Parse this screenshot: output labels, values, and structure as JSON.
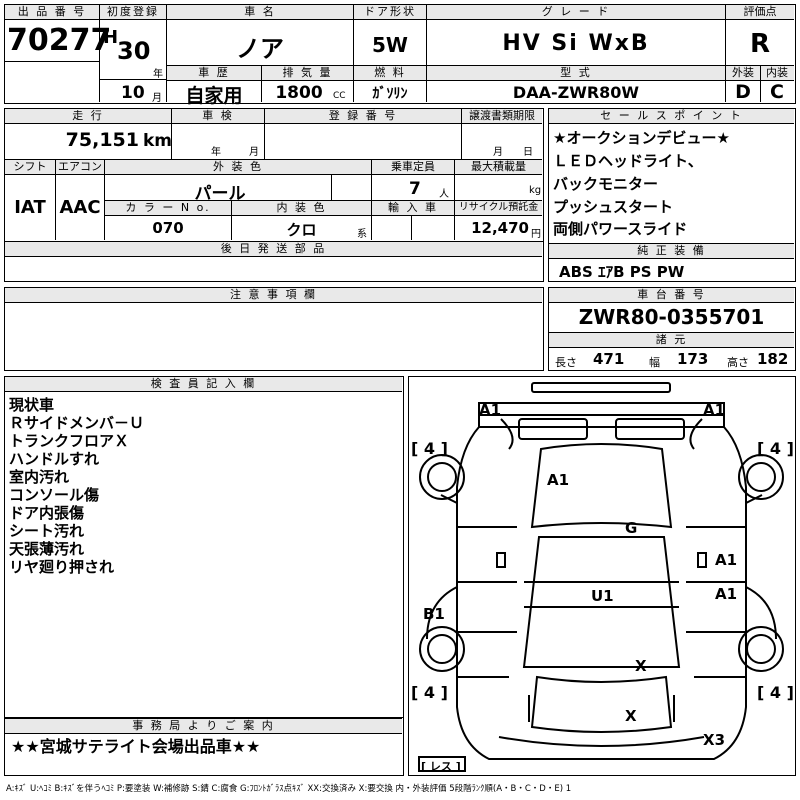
{
  "header": {
    "lot_no_label": "出 品 番 号",
    "lot_no": "70277",
    "first_reg_label": "初度登録",
    "era": "H",
    "year": "30",
    "year_unit": "年",
    "month": "10",
    "month_unit": "月",
    "car_name_label": "車 名",
    "car_name": "ノア",
    "history_label": "車 歴",
    "history": "自家用",
    "displacement_label": "排 気 量",
    "displacement": "1800",
    "displacement_unit": "CC",
    "door_label": "ドア形状",
    "door": "5W",
    "fuel_label": "燃 料",
    "fuel": "ｶﾞｿﾘﾝ",
    "grade_label": "グ レ ー ド",
    "grade": "HV Si WxB",
    "model_label": "型 式",
    "model": "DAA-ZWR80W",
    "score_label": "評価点",
    "score": "R",
    "ext_label": "外装",
    "ext": "D",
    "int_label": "内装",
    "int": "C"
  },
  "row2": {
    "mileage_label": "走 行",
    "mileage": "75,151",
    "mileage_unit": "km",
    "inspection_label": "車 検",
    "insp_year_unit": "年",
    "insp_month_unit": "月",
    "reg_no_label": "登 録 番 号",
    "transfer_label": "譲渡書類期限",
    "transfer_month_unit": "月",
    "transfer_day_unit": "日",
    "shift_label": "シフト",
    "shift": "IAT",
    "ac_label": "エアコン",
    "ac": "AAC",
    "color_label": "外 装 色",
    "color": "パール",
    "capacity_label": "乗車定員",
    "capacity": "7",
    "capacity_unit": "人",
    "load_label": "最大積載量",
    "load_unit": "kg",
    "color_no_label": "カ ラ ー N o.",
    "color_no": "070",
    "interior_color_label": "内 装 色",
    "interior_color": "クロ",
    "interior_color_unit": "系",
    "import_label": "輸 入 車",
    "recycle_label": "リサイクル預託金",
    "recycle": "12,470",
    "recycle_unit": "円",
    "later_parts_label": "後 日 発 送 部 品"
  },
  "sales_points": {
    "label": "セ ー ル ス ポ イ ン ト",
    "items": [
      "★オークションデビュー★",
      "ＬＥＤヘッドライト、",
      "バックモニター",
      "プッシュスタート",
      "両側パワースライド"
    ]
  },
  "equipment": {
    "label": "純 正 装 備",
    "value": "ABS ｴｱB PS PW"
  },
  "notes": {
    "label": "注 意 事 項 欄"
  },
  "chassis": {
    "label": "車 台 番 号",
    "value": "ZWR80-0355701",
    "spec_label": "諸 元",
    "length_label": "長さ",
    "length": "471",
    "width_label": "幅",
    "width": "173",
    "height_label": "高さ",
    "height": "182"
  },
  "inspector": {
    "label": "検 査 員 記 入 欄",
    "lines": [
      "現状車",
      "Ｒサイドメンバ－Ｕ",
      "トランクフロアＸ",
      "ハンドルすれ",
      "室内汚れ",
      "コンソール傷",
      "ドア内張傷",
      "シート汚れ",
      "天張薄汚れ",
      "リヤ廻り押され"
    ]
  },
  "office": {
    "label": "事 務 局 よ り ご 案 内",
    "message": "★★宮城サテライト会場出品車★★"
  },
  "diagram": {
    "marks": {
      "a1_tl": "A1",
      "a1_tr": "A1",
      "a1_hood": "A1",
      "g": "G",
      "a1_r1": "A1",
      "a1_r2": "A1",
      "u1": "U1",
      "b1": "B1",
      "x_rear": "X",
      "x_bottom": "X",
      "x3": "X3"
    },
    "tires": {
      "fl": "4",
      "fr": "4",
      "rl": "4",
      "rr": "4"
    },
    "spare": "レス"
  },
  "legend": "A:ｷｽﾞ U:ﾍｺﾐ B:ｷｽﾞを伴うﾍｺﾐ P:要塗装 W:補修跡 S:錆 C:腐食 G:ﾌﾛﾝﾄｶﾞﾗｽ点ｷｽﾞ XX:交換済み X:要交換 内・外装評価 5段階ﾗﾝｸ順(A・B・C・D・E) 1"
}
